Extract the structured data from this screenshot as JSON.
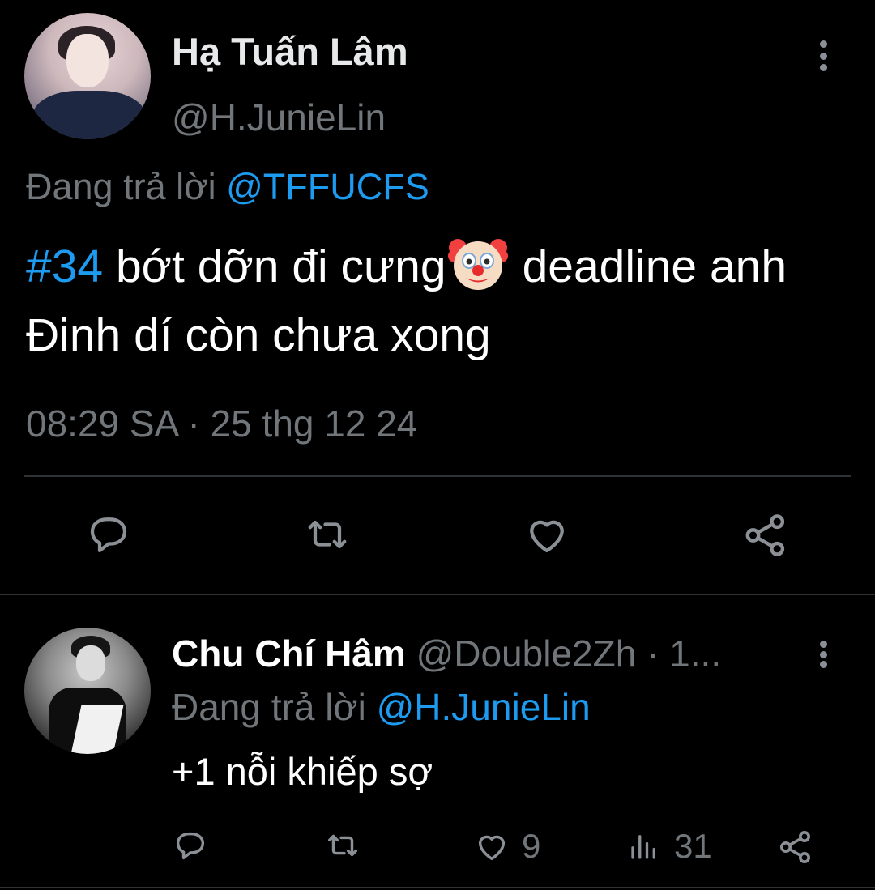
{
  "main_tweet": {
    "author_name": "Hạ Tuấn Lâm",
    "author_handle": "@H.JunieLin",
    "reply_prefix": "Đang trả lời",
    "reply_to": "@TFFUCFS",
    "text": {
      "hashtag": "#34",
      "part1": " bớt dỡn đi cưng",
      "emoji_name": "clown-face-icon",
      "part2": "deadline anh Đinh dí còn chưa xong"
    },
    "timestamp": "08:29 SA · 25 thg 12 24",
    "actions": [
      "reply-icon",
      "retweet-icon",
      "like-icon",
      "share-icon"
    ]
  },
  "reply_tweet": {
    "author_name": "Chu Chí Hâm",
    "author_handle": "@Double2Zh · 1...",
    "reply_prefix": "Đang trả lời",
    "reply_to": "@H.JunieLin",
    "text": "+1 nỗi khiếp sợ",
    "like_count": "9",
    "view_count": "31",
    "actions": [
      "reply-icon",
      "retweet-icon",
      "like-icon",
      "views-icon",
      "share-icon"
    ]
  },
  "colors": {
    "background": "#000000",
    "text": "#e7e9ea",
    "muted": "#71767b",
    "accent": "#1d9bf0",
    "divider": "#2f3336"
  }
}
